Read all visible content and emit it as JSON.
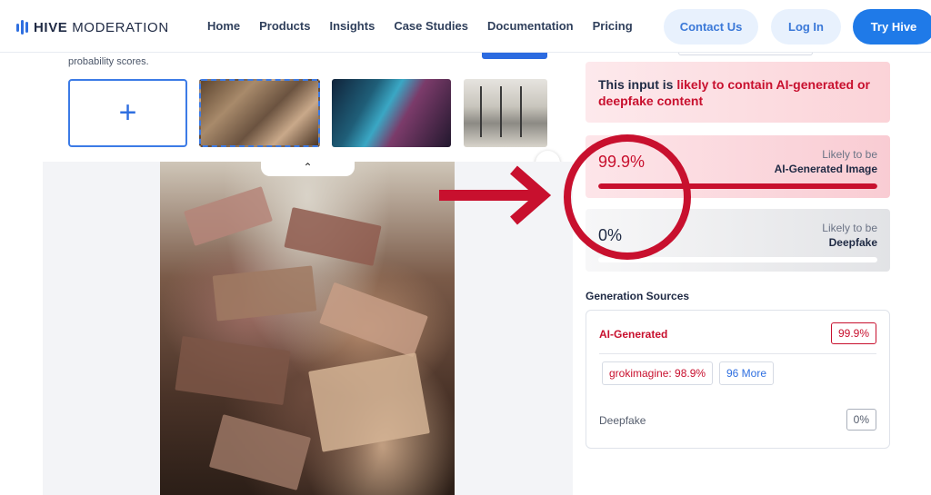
{
  "nav": {
    "brand_bold": "HIVE",
    "brand_light": "MODERATION",
    "links": [
      "Home",
      "Products",
      "Insights",
      "Case Studies",
      "Documentation",
      "Pricing"
    ],
    "contact": "Contact Us",
    "login": "Log In",
    "try": "Try Hive"
  },
  "left": {
    "cut_text": "probability scores.",
    "add_symbol": "+",
    "collapse_symbol": "⌃",
    "next_symbol": "›"
  },
  "result": {
    "verdict_prefix": "This input is ",
    "verdict_highlight": "likely to contain AI-generated or deepfake content",
    "ai": {
      "value": "99.9%",
      "likely": "Likely to be",
      "label": "AI-Generated Image",
      "fraction": 0.999
    },
    "deepfake": {
      "value": "0%",
      "likely": "Likely to be",
      "label": "Deepfake",
      "fraction": 0.0
    }
  },
  "sources": {
    "title": "Generation Sources",
    "ai_label": "AI-Generated",
    "ai_value": "99.9%",
    "chip_grok": "grokimagine: 98.9%",
    "chip_more": "96 More",
    "deepfake_label": "Deepfake",
    "deepfake_value": "0%"
  },
  "colors": {
    "accent": "#1f7ae8",
    "alert": "#c8102e",
    "annotation": "#c8102e"
  }
}
